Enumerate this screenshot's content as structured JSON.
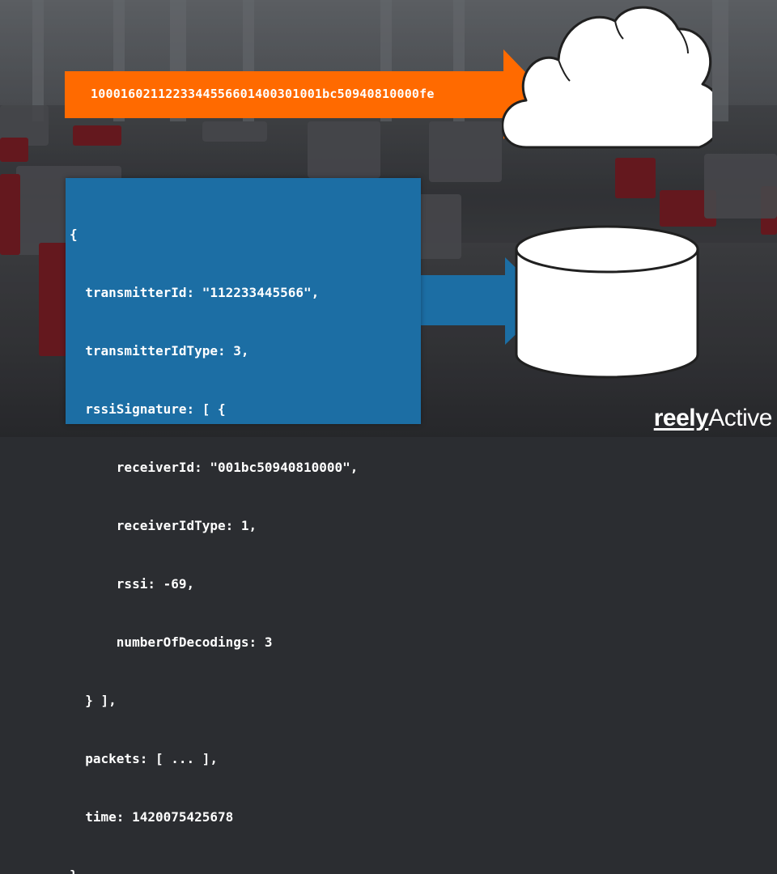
{
  "packet": {
    "hex": "1000160211223344556601400301001bc50940810000fe"
  },
  "json_record": {
    "lines": [
      "{",
      "  transmitterId: \"112233445566\",",
      "  transmitterIdType: 3,",
      "  rssiSignature: [ {",
      "      receiverId: \"001bc50940810000\",",
      "      receiverIdType: 1,",
      "      rssi: -69,",
      "      numberOfDecodings: 3",
      "  } ],",
      "  packets: [ ... ],",
      "  time: 1420075425678",
      "}"
    ]
  },
  "logo": {
    "bold": "reely",
    "regular": "Active"
  },
  "colors": {
    "orange": "#ff6a00",
    "blue": "#1c6ea4",
    "white": "#ffffff"
  },
  "icons": {
    "cloud": "cloud-icon",
    "database": "database-icon"
  }
}
